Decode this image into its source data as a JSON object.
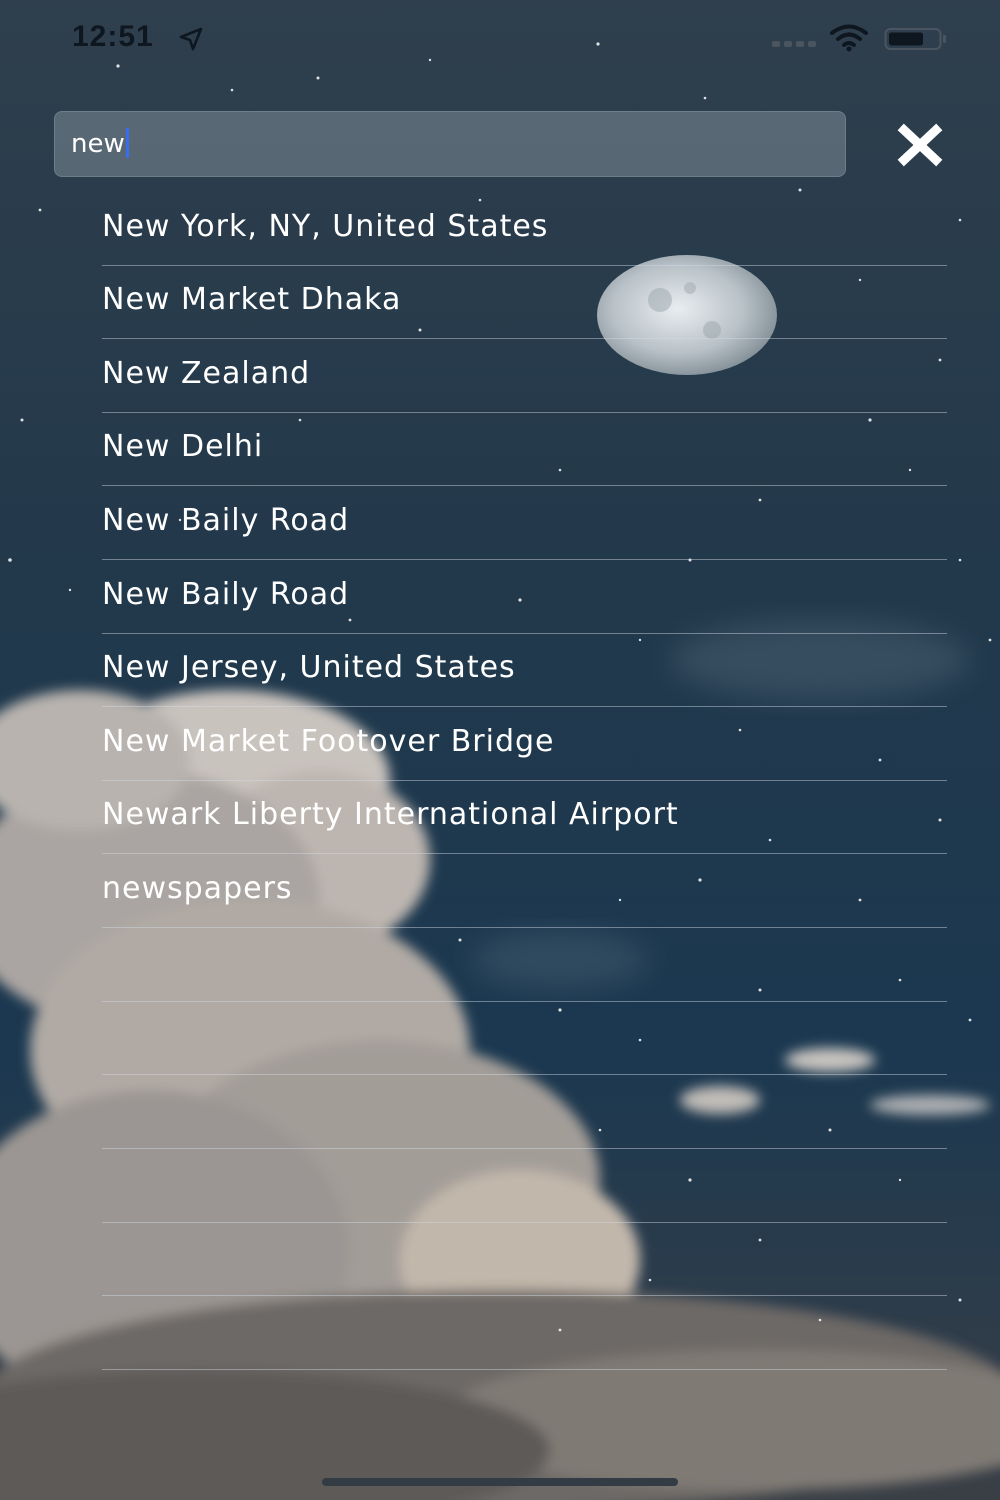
{
  "status_bar": {
    "time": "12:51",
    "icons": [
      "location-arrow-icon",
      "cellular-signal-icon",
      "wifi-icon",
      "battery-icon"
    ]
  },
  "search": {
    "value": "new"
  },
  "close_icon": "close-x-icon",
  "results": [
    "New York, NY, United States",
    "New Market Dhaka",
    "New Zealand",
    "New Delhi",
    "New Baily Road",
    "New Baily Road",
    "New Jersey, United States",
    "New Market Footover Bridge",
    "Newark Liberty International Airport",
    "newspapers",
    "",
    "",
    "",
    "",
    "",
    ""
  ],
  "colors": {
    "sky_top": "#2b3e4e",
    "sky_bottom": "#173349",
    "caret": "#3a6cf0",
    "text": "#ffffff"
  }
}
